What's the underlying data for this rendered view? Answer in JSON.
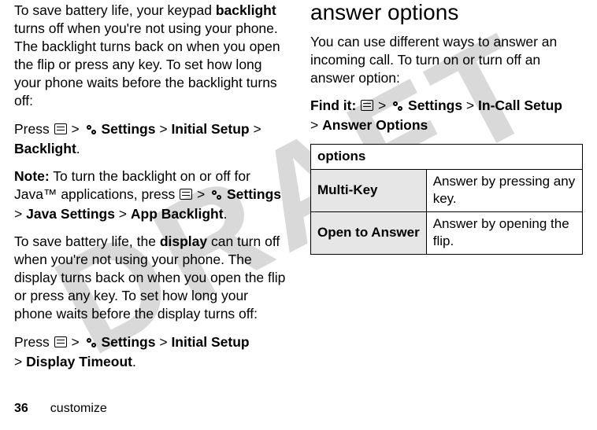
{
  "watermark": "DRAFT",
  "left": {
    "p1_a": "To save battery life, your keypad ",
    "p1_backlight": "backlight",
    "p1_b": " turns off when you're not using your phone. The backlight turns back on when you open the flip or press any key. To set how long your phone waits before the backlight turns off:",
    "p2_press": "Press ",
    "gt": " > ",
    "settings": "Settings",
    "initial_setup": "Initial Setup",
    "backlight_label": "Backlight",
    "period": ".",
    "note_label": "Note:",
    "note_text": " To turn the backlight on or off for Java™ applications, press ",
    "java_settings": "Java Settings",
    "app_backlight": "App Backlight",
    "p4_a": "To save battery life, the ",
    "display_word": "display",
    "p4_b": " can turn off when you're not using your phone. The display turns back on when you open the flip or press any key. To set how long your phone waits before the display turns off:",
    "display_timeout": "Display Timeout"
  },
  "right": {
    "heading": "answer options",
    "intro": "You can use different ways to answer an incoming call. To turn on or turn off an answer option:",
    "find_it": "Find it:",
    "in_call_setup": "In-Call Setup",
    "answer_options": "Answer Options",
    "table": {
      "header": "options",
      "rows": [
        {
          "k": "Multi-Key",
          "v": "Answer by pressing any key."
        },
        {
          "k": "Open to Answer",
          "v": "Answer by opening the flip."
        }
      ]
    }
  },
  "footer": {
    "page": "36",
    "section": "customize"
  }
}
